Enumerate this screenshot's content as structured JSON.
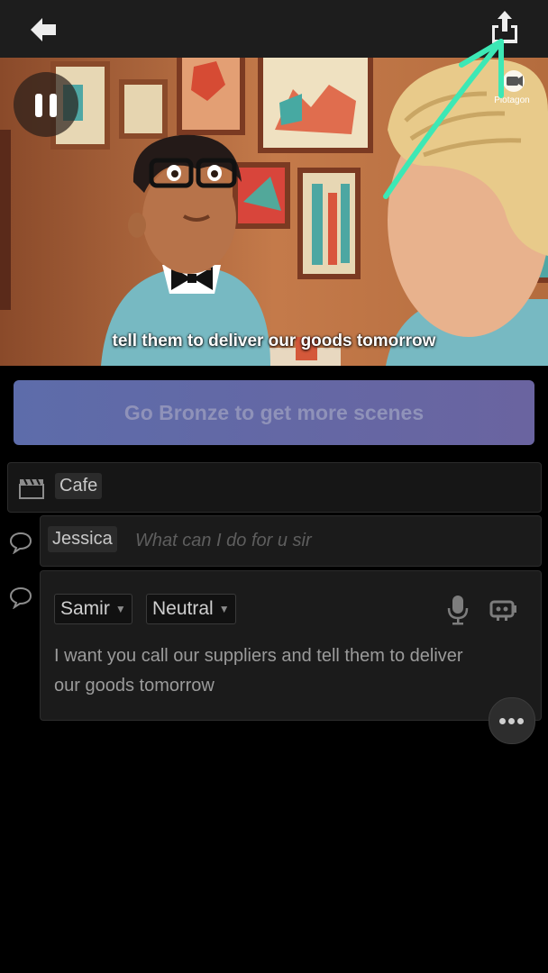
{
  "video": {
    "subtitle": "tell them to deliver our goods tomorrow",
    "watermark": "Plotagon"
  },
  "upgrade": {
    "label": "Go Bronze to get more scenes"
  },
  "scene": {
    "location": "Cafe"
  },
  "lines": [
    {
      "speaker": "Jessica",
      "placeholder": "What can I do for u sir"
    },
    {
      "speaker": "Samir",
      "mood": "Neutral",
      "text": "I want you call our suppliers and tell them to deliver our goods tomorrow"
    }
  ],
  "icons": {
    "back": "arrow-left-icon",
    "share": "share-icon",
    "pause": "pause-icon",
    "scene": "clapperboard-icon",
    "line": "speech-bubble-icon",
    "mic": "microphone-icon",
    "camera": "camera-icon",
    "more": "more-icon"
  },
  "colors": {
    "annotation": "#3de8b5",
    "upgrade_button": "#6068a6",
    "background": "#000000"
  }
}
